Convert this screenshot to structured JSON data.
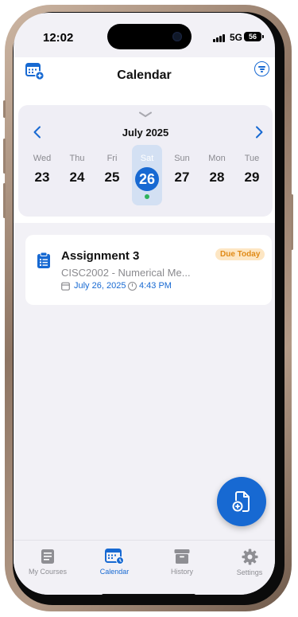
{
  "status_bar": {
    "time": "12:02",
    "network": "5G",
    "battery": "56"
  },
  "header": {
    "title": "Calendar",
    "add_icon": "calendar-plus-icon",
    "filter_icon": "filter-icon"
  },
  "week": {
    "month_label": "July 2025",
    "days": [
      {
        "name": "Wed",
        "num": "23"
      },
      {
        "name": "Thu",
        "num": "24"
      },
      {
        "name": "Fri",
        "num": "25"
      },
      {
        "name": "Sat",
        "num": "26",
        "selected": true,
        "has_event": true
      },
      {
        "name": "Sun",
        "num": "27"
      },
      {
        "name": "Mon",
        "num": "28"
      },
      {
        "name": "Tue",
        "num": "29"
      }
    ]
  },
  "assignment": {
    "title": "Assignment 3",
    "badge": "Due Today",
    "course": "CISC2002 - Numerical Me...",
    "date": "July 26, 2025",
    "time": "4:43 PM",
    "icon": "clipboard-list-icon"
  },
  "fab": {
    "icon": "add-document-icon"
  },
  "tabs": [
    {
      "label": "My Courses",
      "icon": "courses-icon"
    },
    {
      "label": "Calendar",
      "icon": "calendar-icon",
      "active": true
    },
    {
      "label": "History",
      "icon": "archive-icon"
    },
    {
      "label": "Settings",
      "icon": "gear-icon"
    }
  ],
  "colors": {
    "accent": "#1769d2",
    "badge_bg": "#fde6c3",
    "badge_text": "#e08a16",
    "event_dot": "#2fb35c",
    "background": "#f2f1f6"
  }
}
